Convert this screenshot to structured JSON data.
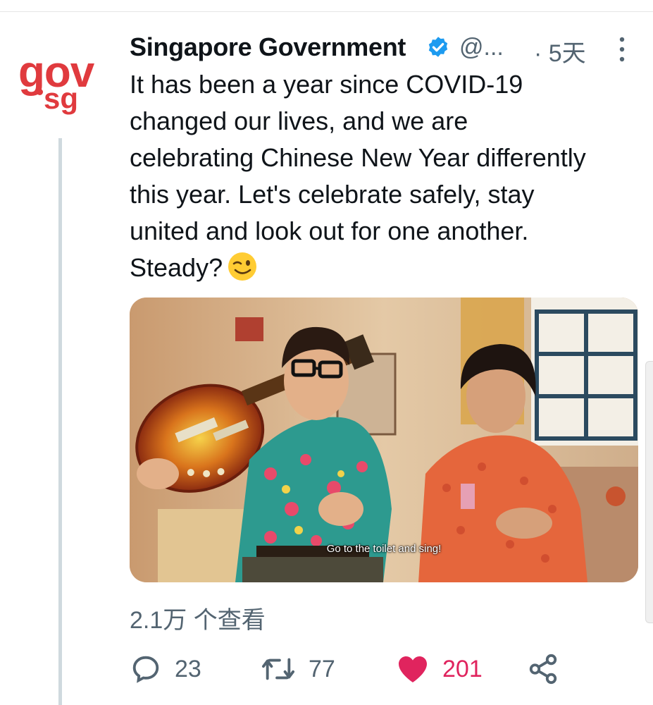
{
  "account": {
    "logo_text_top": "gov",
    "logo_text_bottom": "sg",
    "name": "Singapore Government",
    "handle": "@...",
    "time": "· 5天",
    "verified_icon": "verified-badge-icon"
  },
  "tweet": {
    "text": "It has been a year since COVID-19\nchanged our lives, and we are\ncelebrating Chinese New Year differently\nthis year. Let's celebrate safely, stay\nunited and look out for one another.\nSteady?",
    "emoji": "wink-emoji"
  },
  "media": {
    "caption": "Go to the toilet and sing!"
  },
  "views": "2.1万 个查看",
  "actions": {
    "reply_count": "23",
    "retweet_count": "77",
    "like_count": "201"
  },
  "colors": {
    "brand_red": "#e03a3e",
    "verified_blue": "#1d9bf0",
    "like_pink": "#e0245e",
    "meta_gray": "#536471"
  }
}
